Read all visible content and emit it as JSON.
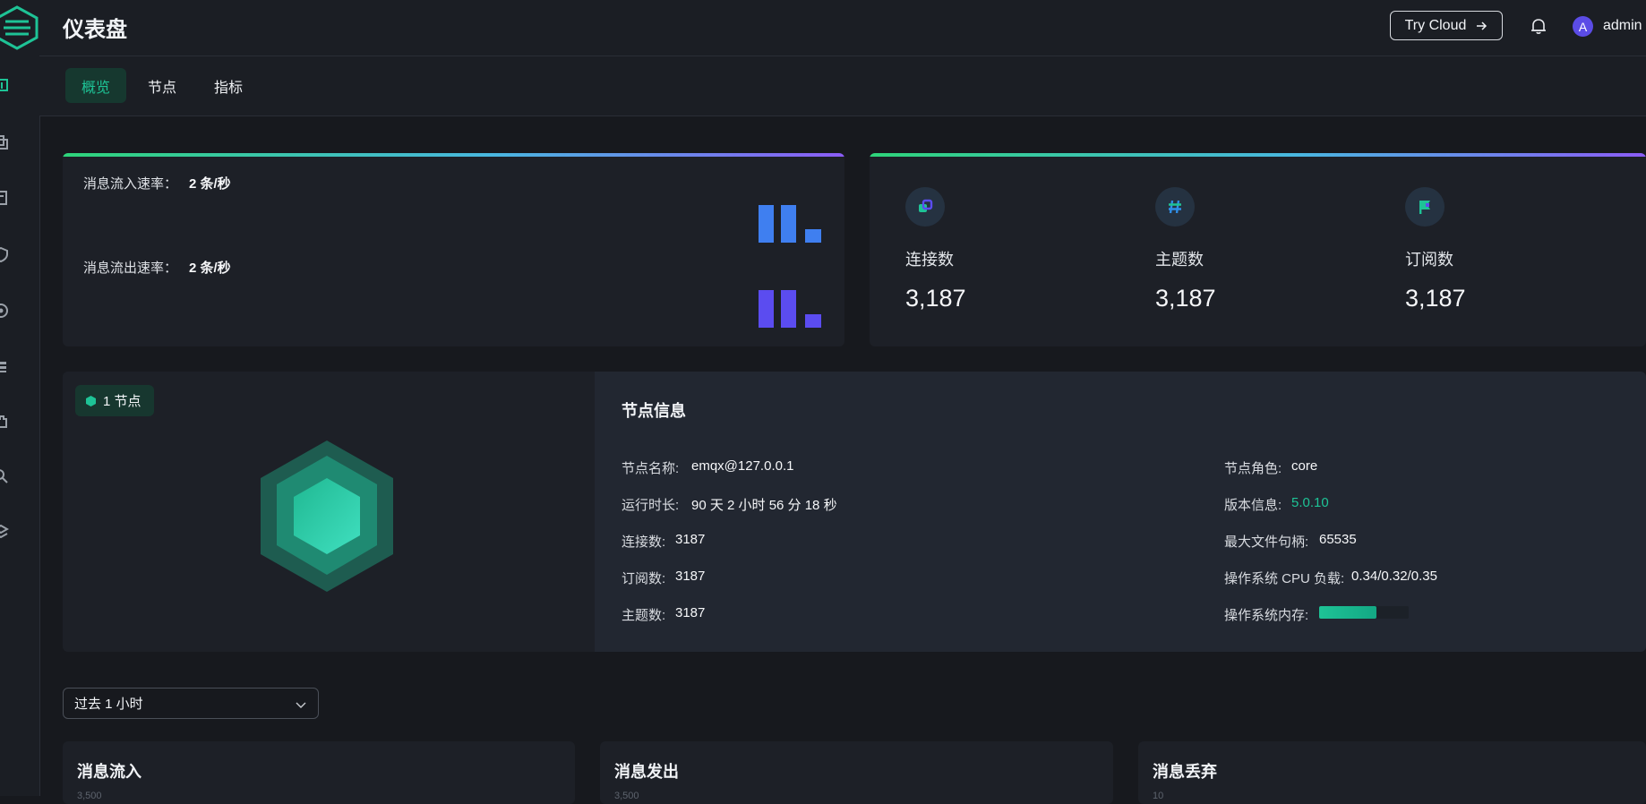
{
  "header": {
    "title": "仪表盘",
    "try_cloud": "Try Cloud",
    "user": "admin",
    "avatar_letter": "A"
  },
  "tabs": [
    {
      "label": "概览",
      "active": true
    },
    {
      "label": "节点"
    },
    {
      "label": "指标"
    }
  ],
  "rates": {
    "in_label": "消息流入速率：",
    "in_value": "2 条/秒",
    "out_label": "消息流出速率：",
    "out_value": "2 条/秒"
  },
  "stats": [
    {
      "label": "连接数",
      "value": "3,187",
      "icon": "connections-icon"
    },
    {
      "label": "主题数",
      "value": "3,187",
      "icon": "hash-icon"
    },
    {
      "label": "订阅数",
      "value": "3,187",
      "icon": "flag-icon"
    }
  ],
  "node": {
    "badge": "1 节点",
    "title": "节点信息",
    "left": [
      {
        "label": "节点名称:",
        "value": "emqx@127.0.0.1"
      },
      {
        "label": "运行时长:",
        "value": "90 天 2 小时 56 分 18 秒"
      },
      {
        "label": "连接数:",
        "value": "3187"
      },
      {
        "label": "订阅数:",
        "value": "3187"
      },
      {
        "label": "主题数:",
        "value": "3187"
      }
    ],
    "right": [
      {
        "label": "节点角色:",
        "value": "core"
      },
      {
        "label": "版本信息:",
        "value": "5.0.10"
      },
      {
        "label": "最大文件句柄:",
        "value": "65535"
      },
      {
        "label": "操作系统 CPU 负载:",
        "value": "0.34/0.32/0.35"
      },
      {
        "label": "操作系统内存:"
      }
    ],
    "memory_usage": 0.64
  },
  "time_range": {
    "selected": "过去 1 小时"
  },
  "charts": [
    {
      "title": "消息流入",
      "first_tick": "3,500"
    },
    {
      "title": "消息发出",
      "first_tick": "3,500"
    },
    {
      "title": "消息丢弃",
      "first_tick": "10"
    }
  ],
  "colors": {
    "accent": "#1ec396",
    "in_bar": "#3f7ff0",
    "out_bar": "#5b4cf0"
  }
}
